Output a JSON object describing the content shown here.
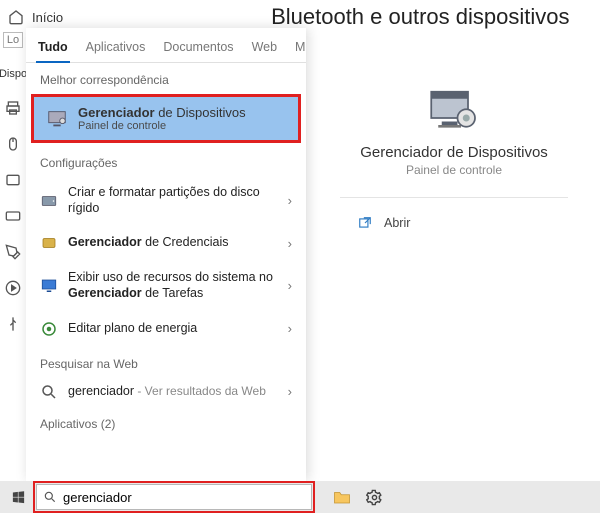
{
  "header": {
    "home_label": "Início",
    "settings_title": "Bluetooth e outros dispositivos"
  },
  "tabs": {
    "all": "Tudo",
    "apps": "Aplicativos",
    "docs": "Documentos",
    "web": "Web",
    "more": "Mais"
  },
  "sections": {
    "best_match": "Melhor correspondência",
    "settings": "Configurações",
    "search_web": "Pesquisar na Web",
    "apps_count": "Aplicativos (2)"
  },
  "best_match": {
    "title_bold": "Gerenciador",
    "title_rest": " de Dispositivos",
    "subtitle": "Painel de controle"
  },
  "results": {
    "partitions": "Criar e formatar partições do disco rígido",
    "credentials_bold": "Gerenciador",
    "credentials_rest": " de Credenciais",
    "resources_pre": "Exibir uso de recursos do sistema no ",
    "resources_bold": "Gerenciador",
    "resources_post": " de Tarefas",
    "energy": "Editar plano de energia",
    "web_term": "gerenciador",
    "web_suffix": " - Ver resultados da Web"
  },
  "preview": {
    "title": "Gerenciador de Dispositivos",
    "subtitle": "Painel de controle",
    "open": "Abrir"
  },
  "taskbar": {
    "search_value": "gerenciador"
  },
  "leftrail_labels": {
    "locate": "Lo",
    "devices": "Dispo"
  }
}
